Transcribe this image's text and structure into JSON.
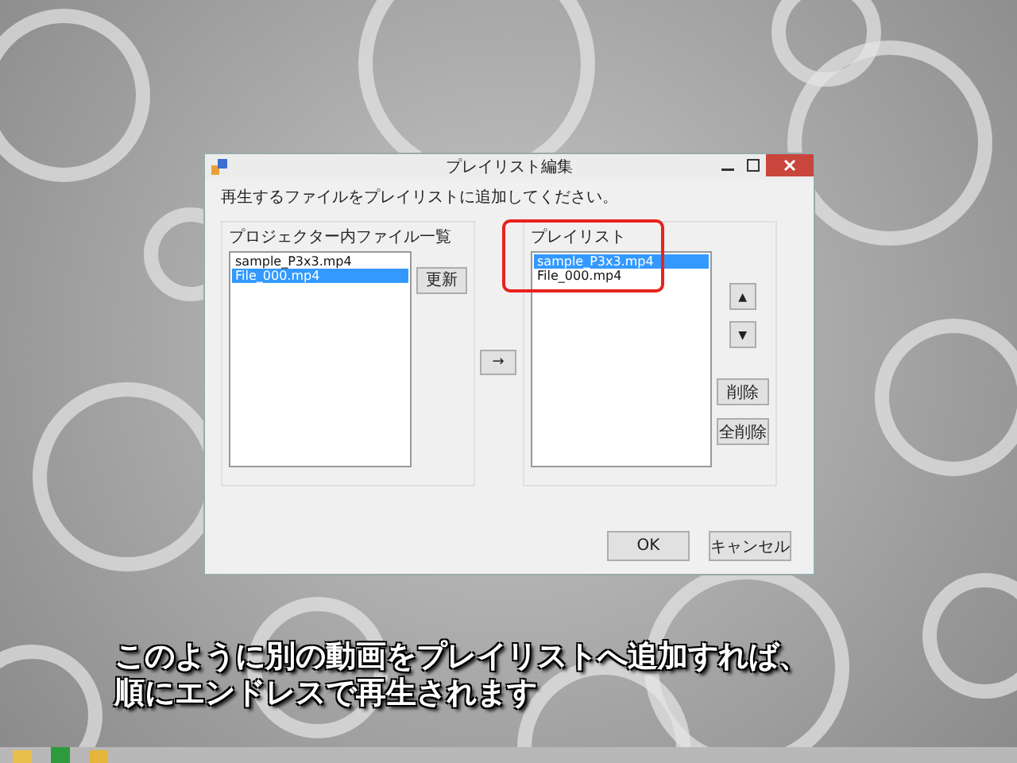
{
  "window": {
    "title": "プレイリスト編集"
  },
  "instruction": "再生するファイルをプレイリストに追加してください。",
  "source_group": {
    "label": "プロジェクター内ファイル一覧",
    "items": [
      {
        "name": "sample_P3x3.mp4",
        "selected": false
      },
      {
        "name": "File_000.mp4",
        "selected": true
      }
    ]
  },
  "refresh_button": "更新",
  "add_button": "→",
  "playlist_group": {
    "label": "プレイリスト",
    "items": [
      {
        "name": "sample_P3x3.mp4",
        "selected": true
      },
      {
        "name": "File_000.mp4",
        "selected": false
      }
    ]
  },
  "move_up_button": "▲",
  "move_down_button": "▼",
  "delete_button": "削除",
  "delete_all_button": "全削除",
  "dialog_buttons": [
    "OK",
    "キャンセル"
  ],
  "caption": [
    "このように別の動画をプレイリストへ追加すれば、",
    "順にエンドレスで再生されます"
  ]
}
